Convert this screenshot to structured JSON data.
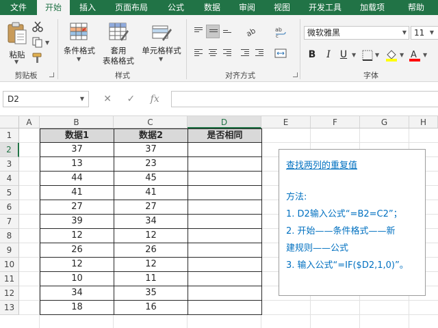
{
  "tabs": [
    {
      "label": "文件",
      "active": false
    },
    {
      "label": "开始",
      "active": true
    },
    {
      "label": "插入",
      "active": false
    },
    {
      "label": "页面布局",
      "active": false
    },
    {
      "label": "公式",
      "active": false
    },
    {
      "label": "数据",
      "active": false
    },
    {
      "label": "审阅",
      "active": false
    },
    {
      "label": "视图",
      "active": false
    },
    {
      "label": "开发工具",
      "active": false
    },
    {
      "label": "加载项",
      "active": false
    },
    {
      "label": "帮助",
      "active": false
    }
  ],
  "ribbon": {
    "clipboard": {
      "paste_label": "粘贴",
      "group_label": "剪贴板"
    },
    "styles": {
      "conditional_format_label": "条件格式",
      "table_format_label_1": "套用",
      "table_format_label_2": "表格格式",
      "cell_styles_label": "单元格样式",
      "group_label": "样式"
    },
    "alignment": {
      "group_label": "对齐方式"
    },
    "font": {
      "font_name": "微软雅黑",
      "font_size": "11",
      "group_label": "字体"
    }
  },
  "formula_bar": {
    "name_box": "D2",
    "cancel_symbol": "✕",
    "enter_symbol": "✓",
    "fx_symbol": "fx",
    "formula": ""
  },
  "columns": [
    "A",
    "B",
    "C",
    "D",
    "E",
    "F",
    "G",
    "H"
  ],
  "selected_column": "D",
  "rows": [
    "1",
    "2",
    "3",
    "4",
    "5",
    "6",
    "7",
    "8",
    "9",
    "10",
    "11",
    "12",
    "13"
  ],
  "selected_row": "2",
  "table": {
    "headers": [
      "数据1",
      "数据2",
      "是否相同"
    ],
    "rows": [
      [
        "37",
        "37",
        ""
      ],
      [
        "13",
        "23",
        ""
      ],
      [
        "44",
        "45",
        ""
      ],
      [
        "41",
        "41",
        ""
      ],
      [
        "27",
        "27",
        ""
      ],
      [
        "39",
        "34",
        ""
      ],
      [
        "12",
        "12",
        ""
      ],
      [
        "26",
        "26",
        ""
      ],
      [
        "12",
        "12",
        ""
      ],
      [
        "10",
        "11",
        ""
      ],
      [
        "34",
        "35",
        ""
      ],
      [
        "18",
        "16",
        ""
      ]
    ]
  },
  "note": {
    "title": "查找两列的重复值",
    "lines": [
      "方法:",
      "1. D2输入公式“=B2=C2”；",
      "2. 开始——条件格式——新",
      "建规则——公式",
      "3. 输入公式“=IF($D2,1,0)”。"
    ]
  },
  "colors": {
    "brand": "#217346",
    "note_text": "#0070c0",
    "header_fill": "#d9d9d9"
  }
}
